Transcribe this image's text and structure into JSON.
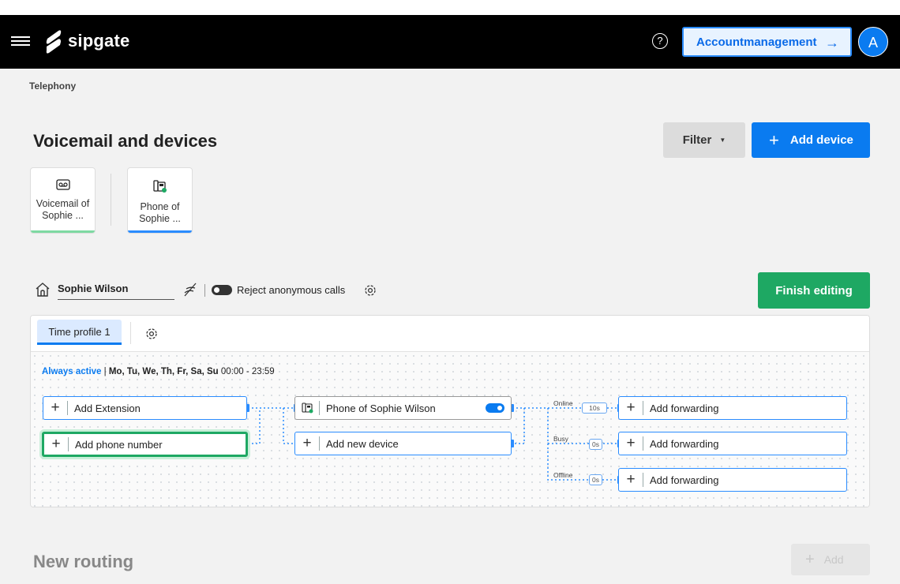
{
  "header": {
    "brand": "sipgate",
    "help_glyph": "?",
    "account_button_label": "Accountmanagement",
    "account_button_arrow": "→",
    "avatar_initial": "A"
  },
  "breadcrumb": "Telephony",
  "page": {
    "title": "Voicemail and devices",
    "filter_label": "Filter",
    "add_device_label": "Add device"
  },
  "device_cards": [
    {
      "line1": "Voicemail of",
      "line2": "Sophie ...",
      "icon": "voicemail-icon",
      "accent": "#7ed9a2"
    },
    {
      "line1": "Phone of",
      "line2": "Sophie ...",
      "icon": "phone-icon",
      "accent": "#2a8cff"
    }
  ],
  "routing": {
    "name": "Sophie Wilson",
    "reject_label": "Reject anonymous calls",
    "reject_enabled": false,
    "finish_label": "Finish editing",
    "time_profile_tab": "Time profile 1",
    "schedule_active": "Always active",
    "schedule_separator": "|",
    "schedule_days": "Mo, Tu, We, Th, Fr, Sa, Su",
    "schedule_time": "00:00 - 23:59",
    "sources": {
      "add_extension": "Add Extension",
      "add_phone_number": "Add phone number"
    },
    "devices": {
      "phone_name": "Phone of Sophie Wilson",
      "phone_enabled": true,
      "add_new_device": "Add new device"
    },
    "forwarding": [
      {
        "condition": "Online",
        "delay": "10s",
        "label": "Add forwarding"
      },
      {
        "condition": "Busy",
        "delay": "0s",
        "label": "Add forwarding"
      },
      {
        "condition": "Offline",
        "delay": "0s",
        "label": "Add forwarding"
      }
    ]
  },
  "new_routing": {
    "title": "New routing",
    "add_label": "Add"
  },
  "colors": {
    "accent_blue": "#0a7bf0",
    "success_green": "#1ea863",
    "navbar": "#000000"
  }
}
